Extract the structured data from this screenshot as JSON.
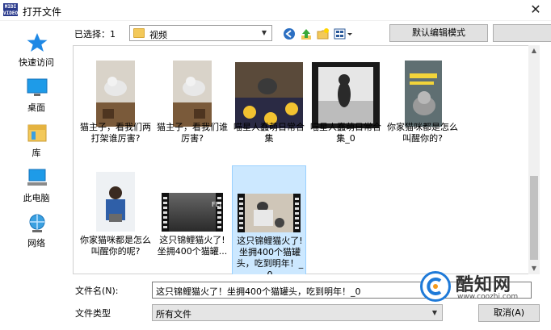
{
  "window": {
    "app_icon_text": [
      "MIDI",
      "VIDEO"
    ],
    "title": "打开文件",
    "close_glyph": "✕"
  },
  "toolbar": {
    "selected_count": "已选择：1",
    "folder": "视频",
    "mode_button": "默认编辑模式",
    "icons": [
      "back-icon",
      "up-icon",
      "new-folder-icon",
      "views-icon"
    ]
  },
  "places": [
    {
      "label": "快速访问",
      "icon": "star-icon"
    },
    {
      "label": "桌面",
      "icon": "desktop-icon"
    },
    {
      "label": "库",
      "icon": "library-icon"
    },
    {
      "label": "此电脑",
      "icon": "computer-icon"
    },
    {
      "label": "网络",
      "icon": "network-icon"
    }
  ],
  "files": [
    {
      "label": "猫主子，看我们两打架谁厉害?",
      "kind": "portrait"
    },
    {
      "label": "猫主子，看我们谁厉害?",
      "kind": "portrait"
    },
    {
      "label": "喵星人蠢萌日常合集",
      "kind": "landscape"
    },
    {
      "label": "喵星人蠢萌日常合集_0",
      "kind": "landscape"
    },
    {
      "label": "你家猫咪都是怎么叫醒你的?",
      "kind": "portrait"
    },
    {
      "label": "你家猫咪都是怎么叫醒你的呢?",
      "kind": "portrait"
    },
    {
      "label": "这只锦鲤猫火了!坐拥400个猫罐...",
      "kind": "film",
      "film_text": "FEI"
    },
    {
      "label": "这只锦鲤猫火了!坐拥400个猫罐头，吃到明年！_0",
      "kind": "film",
      "selected": true
    }
  ],
  "bottom": {
    "filename_label": "文件名(N):",
    "filename_value": "这只锦鲤猫火了！坐拥400个猫罐头，吃到明年！_0",
    "filetype_label": "文件类型",
    "filetype_value": "所有文件",
    "cancel_label": "取消(A)"
  },
  "watermark": {
    "title": "酷知网",
    "url": "www.coozhi.com"
  },
  "colors": {
    "selection_bg": "#cce8ff",
    "selection_border": "#99d1ff",
    "accent_blue": "#1f7ad8"
  }
}
